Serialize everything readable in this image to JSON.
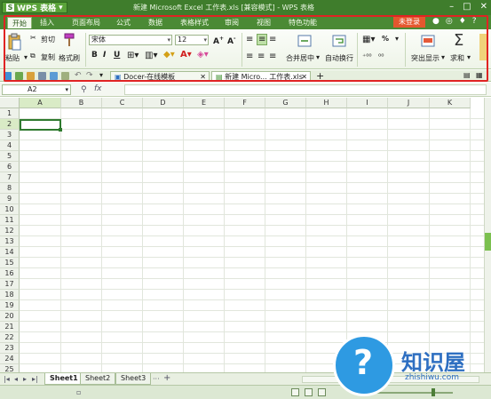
{
  "app": {
    "logo_mark": "S",
    "logo_label": "WPS 表格",
    "window_title": "新建 Microsoft Excel 工作表.xls [兼容模式] - WPS 表格"
  },
  "menu_tabs": [
    "开始",
    "插入",
    "页面布局",
    "公式",
    "数据",
    "表格样式",
    "审阅",
    "视图",
    "特色功能"
  ],
  "login_label": "未登录",
  "ribbon": {
    "paste": "粘贴",
    "cut": "剪切",
    "copy": "复制",
    "format_painter": "格式刷",
    "font_name": "宋体",
    "font_size": "12",
    "merge_center": "合并居中",
    "wrap_text": "自动换行",
    "highlight": "突出显示",
    "sum": "求和",
    "percent": "%"
  },
  "doc_tabs": [
    "Docer-在线模板",
    "新建 Micro... 工作表.xls"
  ],
  "formula_bar": {
    "name_box": "A2",
    "fx": "fx"
  },
  "columns": [
    "A",
    "B",
    "C",
    "D",
    "E",
    "F",
    "G",
    "H",
    "I",
    "J",
    "K"
  ],
  "rows": [
    "1",
    "2",
    "3",
    "4",
    "5",
    "6",
    "7",
    "8",
    "9",
    "10",
    "11",
    "12",
    "13",
    "14",
    "15",
    "16",
    "17",
    "18",
    "19",
    "20",
    "21",
    "22",
    "23",
    "24",
    "25"
  ],
  "sheets": [
    "Sheet1",
    "Sheet2",
    "Sheet3"
  ],
  "watermark": {
    "text": "知识屋",
    "url": "zhishiwu.com"
  }
}
